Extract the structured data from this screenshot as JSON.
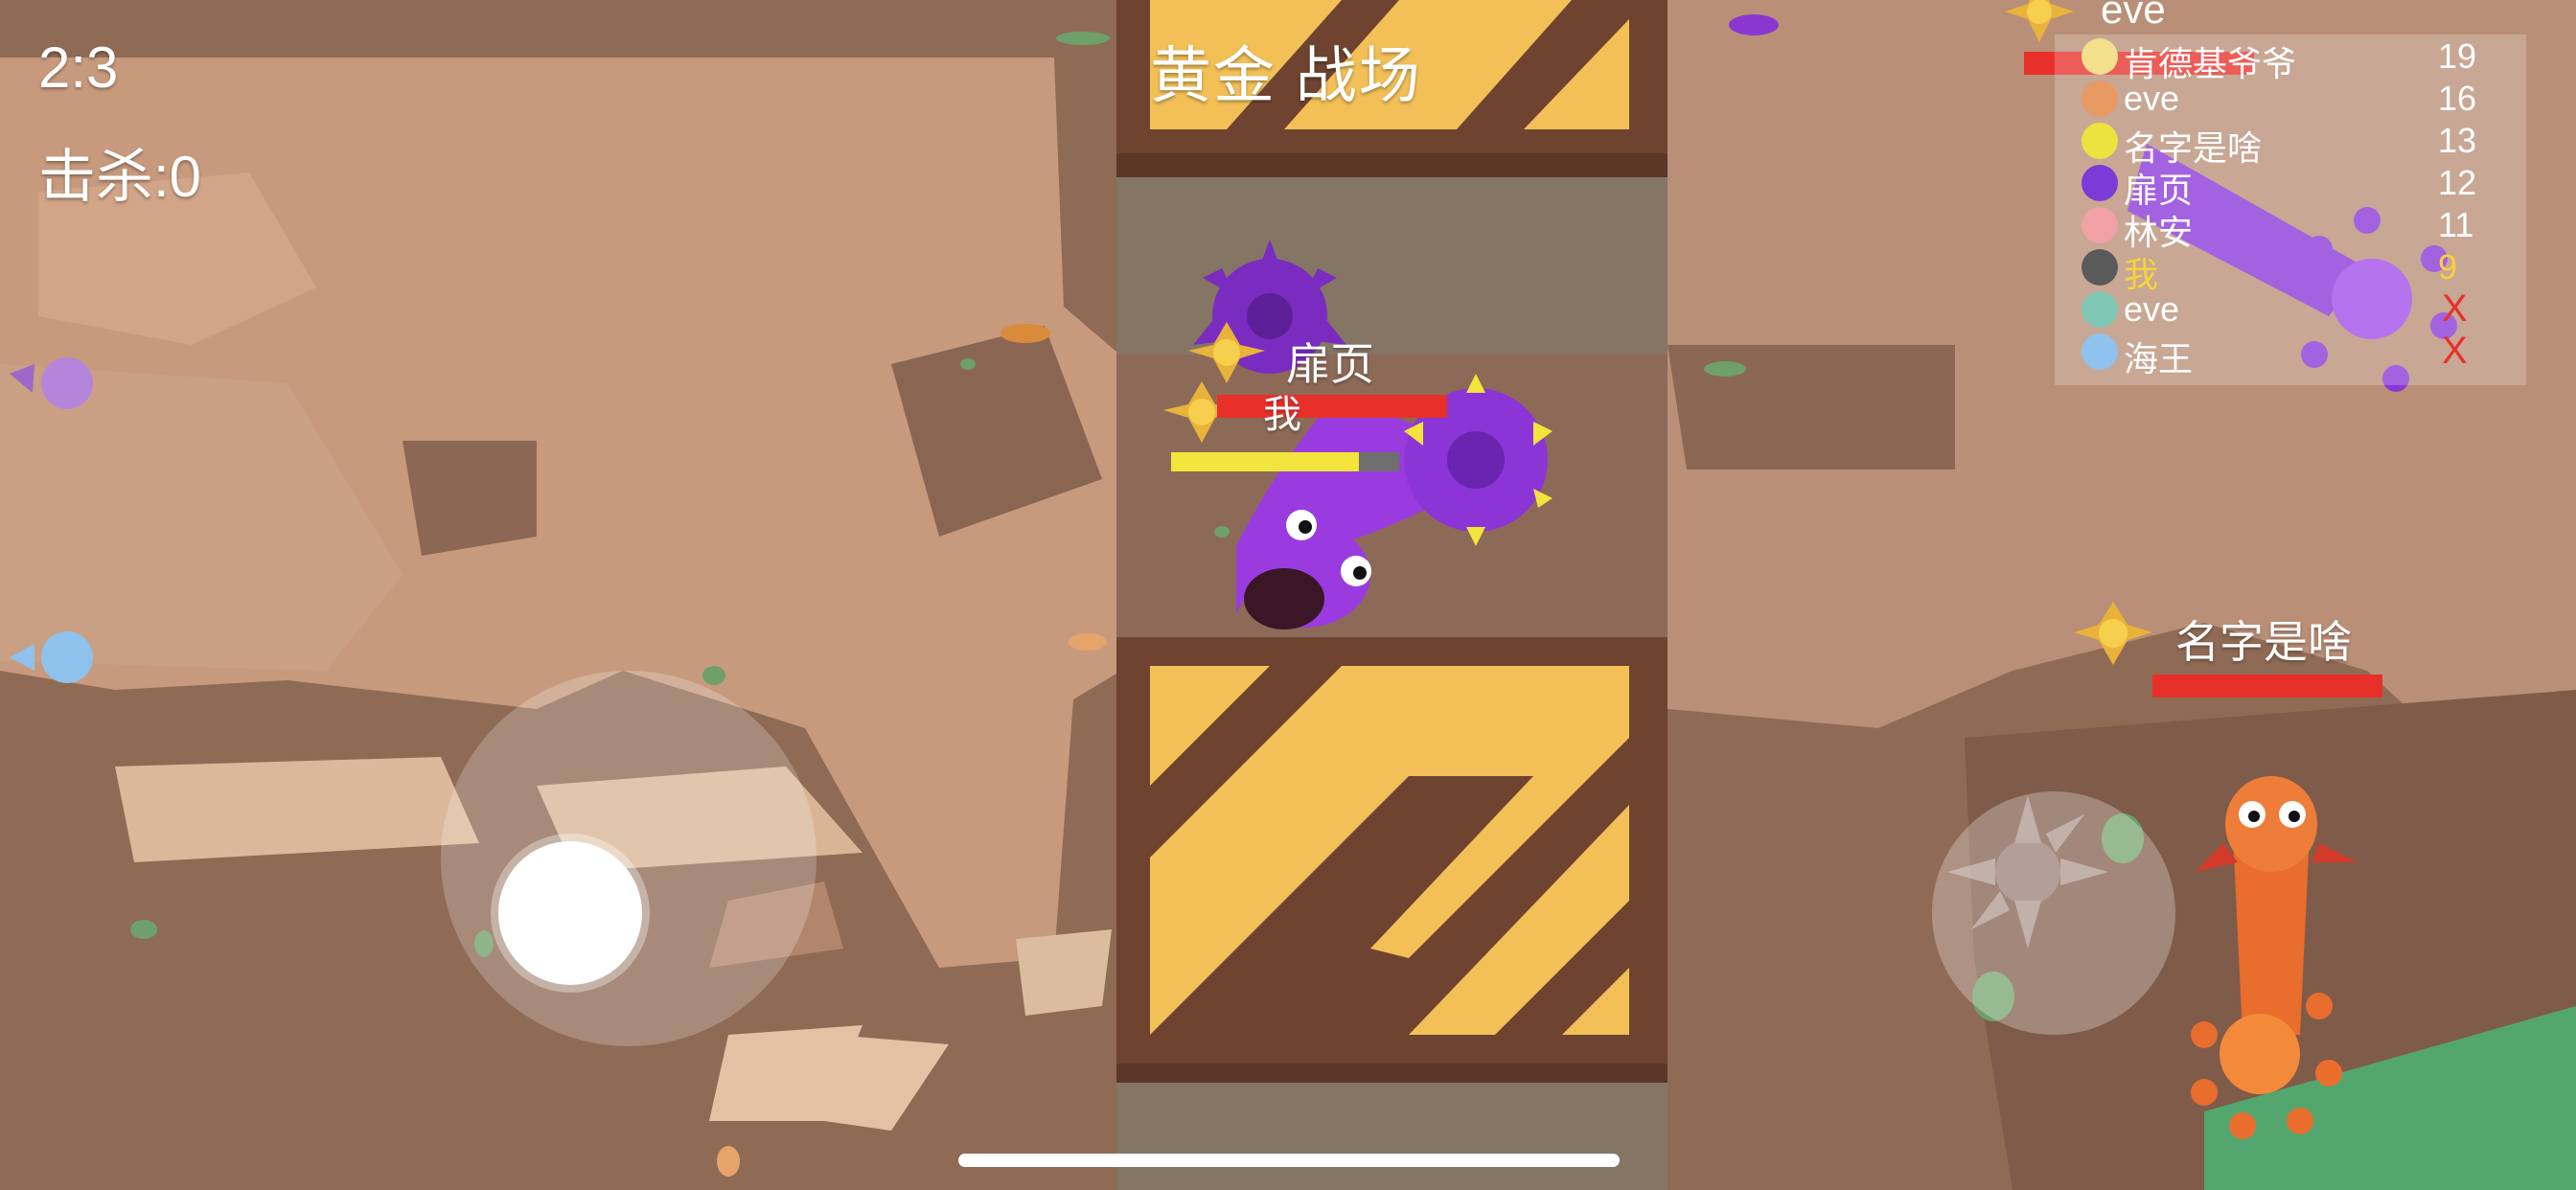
{
  "hud": {
    "time": "2:3",
    "kills": "击杀:0",
    "arena_title": "黄金 战场"
  },
  "players_on_field": {
    "enemy_purple_name": "扉页",
    "self_name": "我",
    "enemy_orange_name": "名字是啥",
    "enemy_top_name": "eve"
  },
  "leaderboard": [
    {
      "name": "肯德基爷爷",
      "score": "19",
      "color": "#f3e08c"
    },
    {
      "name": "eve",
      "score": "16",
      "color": "#e79a63"
    },
    {
      "name": "名字是啥",
      "score": "13",
      "color": "#ece33f"
    },
    {
      "name": "扉页",
      "score": "12",
      "color": "#7c3bd6"
    },
    {
      "name": "林安",
      "score": "11",
      "color": "#f1a0a6"
    },
    {
      "name": "我",
      "score": "9",
      "color": "#5a5a5a",
      "is_me": true
    },
    {
      "name": "eve",
      "score": "",
      "color": "#7fc6b4",
      "eliminated": true
    },
    {
      "name": "海王",
      "score": "",
      "color": "#8fc2ee",
      "eliminated": true
    }
  ],
  "leaderboard_eliminated_mark": "X",
  "colors": {
    "health_red": "#e8302a",
    "energy_yellow": "#f2e43a",
    "wall_yellow": "#f2c057",
    "wall_brown": "#6e4430",
    "snake_purple": "#9a3be0",
    "snake_orange": "#ef7d3a"
  },
  "icons": [
    "star-rank-icon",
    "joystick",
    "ability-button-icon",
    "offscreen-player-arrow-icon"
  ]
}
